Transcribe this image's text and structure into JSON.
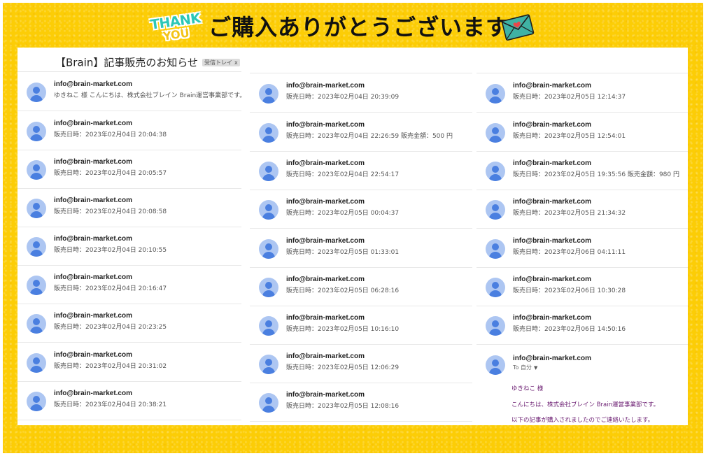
{
  "header": {
    "badge_line1": "THANK",
    "badge_line2": "YOU",
    "title": "ご購入ありがとうございます",
    "envelope_icon": "envelope-heart-icon"
  },
  "colors": {
    "frame": "#fccd06",
    "avatar_bg": "#adc6f2",
    "avatar_fg": "#4a7fe0",
    "body_text": "#6a1b70"
  },
  "mail": {
    "subject": "【Brain】記事販売のお知らせ",
    "label": "受信トレイ",
    "label_close": "x",
    "avatar_icon": "user-avatar-icon",
    "columns": [
      {
        "items": [
          {
            "sender": "info@brain-market.com",
            "snippet": "ゆきねこ 様 こんにちは、株式会社ブレイン Brain運営事業部です。"
          },
          {
            "sender": "info@brain-market.com",
            "snippet": "販売日時：2023年02月04日 20:04:38"
          },
          {
            "sender": "info@brain-market.com",
            "snippet": "販売日時：2023年02月04日 20:05:57"
          },
          {
            "sender": "info@brain-market.com",
            "snippet": "販売日時：2023年02月04日 20:08:58"
          },
          {
            "sender": "info@brain-market.com",
            "snippet": "販売日時：2023年02月04日 20:10:55"
          },
          {
            "sender": "info@brain-market.com",
            "snippet": "販売日時：2023年02月04日 20:16:47"
          },
          {
            "sender": "info@brain-market.com",
            "snippet": "販売日時：2023年02月04日 20:23:25"
          },
          {
            "sender": "info@brain-market.com",
            "snippet": "販売日時：2023年02月04日 20:31:02"
          },
          {
            "sender": "info@brain-market.com",
            "snippet": "販売日時：2023年02月04日 20:38:21"
          }
        ]
      },
      {
        "items": [
          {
            "sender": "info@brain-market.com",
            "snippet": "販売日時：2023年02月04日 20:39:09"
          },
          {
            "sender": "info@brain-market.com",
            "snippet": "販売日時：2023年02月04日 22:26:59 販売金額：500 円"
          },
          {
            "sender": "info@brain-market.com",
            "snippet": "販売日時：2023年02月04日 22:54:17"
          },
          {
            "sender": "info@brain-market.com",
            "snippet": "販売日時：2023年02月05日 00:04:37"
          },
          {
            "sender": "info@brain-market.com",
            "snippet": "販売日時：2023年02月05日 01:33:01"
          },
          {
            "sender": "info@brain-market.com",
            "snippet": "販売日時：2023年02月05日 06:28:16"
          },
          {
            "sender": "info@brain-market.com",
            "snippet": "販売日時：2023年02月05日 10:16:10"
          },
          {
            "sender": "info@brain-market.com",
            "snippet": "販売日時：2023年02月05日 12:06:29"
          },
          {
            "sender": "info@brain-market.com",
            "snippet": "販売日時：2023年02月05日 12:08:16"
          }
        ]
      },
      {
        "items": [
          {
            "sender": "info@brain-market.com",
            "snippet": "販売日時：2023年02月05日 12:14:37"
          },
          {
            "sender": "info@brain-market.com",
            "snippet": "販売日時：2023年02月05日 12:54:01"
          },
          {
            "sender": "info@brain-market.com",
            "snippet": "販売日時：2023年02月05日 19:35:56 販売金額：980 円"
          },
          {
            "sender": "info@brain-market.com",
            "snippet": "販売日時：2023年02月05日 21:34:32"
          },
          {
            "sender": "info@brain-market.com",
            "snippet": "販売日時：2023年02月06日 04:11:11"
          },
          {
            "sender": "info@brain-market.com",
            "snippet": "販売日時：2023年02月06日 10:30:28"
          },
          {
            "sender": "info@brain-market.com",
            "snippet": "販売日時：2023年02月06日 14:50:16"
          }
        ],
        "open_message": {
          "sender": "info@brain-market.com",
          "to": "To 自分",
          "lines": [
            "ゆきねこ 様",
            "こんにちは、株式会社ブレイン Brain運営事業部です。",
            "以下の記事が購入されましたのでご連絡いたします。"
          ]
        }
      }
    ]
  }
}
